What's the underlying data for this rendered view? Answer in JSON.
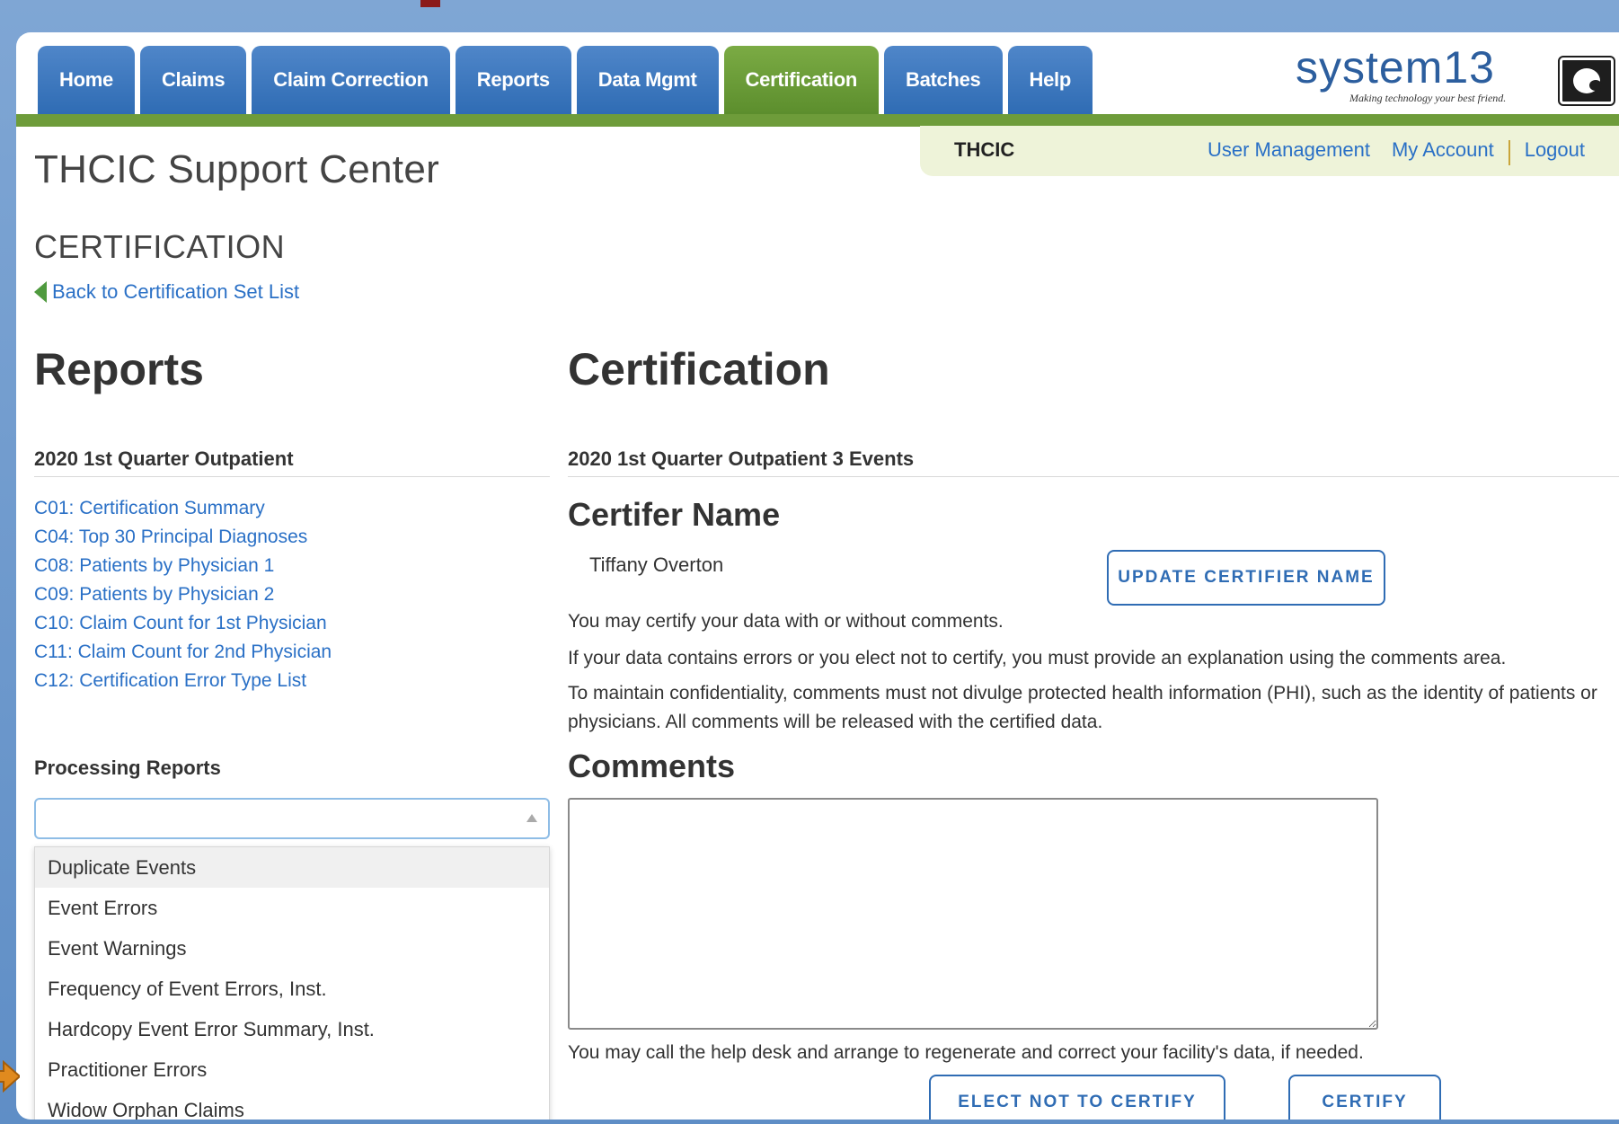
{
  "nav": {
    "tabs": [
      {
        "label": "Home",
        "active": false
      },
      {
        "label": "Claims",
        "active": false
      },
      {
        "label": "Claim Correction",
        "active": false
      },
      {
        "label": "Reports",
        "active": false
      },
      {
        "label": "Data Mgmt",
        "active": false
      },
      {
        "label": "Certification",
        "active": true
      },
      {
        "label": "Batches",
        "active": false
      },
      {
        "label": "Help",
        "active": false
      }
    ]
  },
  "logo": {
    "name": "system13",
    "tagline": "Making technology your best friend."
  },
  "userbar": {
    "org": "THCIC",
    "links": [
      "User Management",
      "My Account",
      "Logout"
    ]
  },
  "site_title": "THCIC Support Center",
  "section_title": "CERTIFICATION",
  "back_link": "Back to Certification Set List",
  "reports": {
    "heading": "Reports",
    "subheading": "2020 1st Quarter Outpatient",
    "links": [
      "C01: Certification Summary",
      "C04: Top 30 Principal Diagnoses",
      "C08: Patients by Physician 1",
      "C09: Patients by Physician 2",
      "C10: Claim Count for 1st Physician",
      "C11: Claim Count for 2nd Physician",
      "C12: Certification Error Type List"
    ],
    "processing_heading": "Processing Reports",
    "processing_value": "",
    "processing_options": [
      "Duplicate Events",
      "Event Errors",
      "Event Warnings",
      "Frequency of Event Errors, Inst.",
      "Hardcopy Event Error Summary, Inst.",
      "Practitioner Errors",
      "Widow Orphan Claims"
    ],
    "highlighted_option": "Duplicate Events"
  },
  "certification": {
    "heading": "Certification",
    "subheading": "2020 1st Quarter Outpatient 3 Events",
    "certifier_heading": "Certifer Name",
    "certifier_name": "Tiffany Overton",
    "update_button": "UPDATE CERTIFIER NAME",
    "para1": "You may certify your data with or without comments.",
    "para2": "If your data contains errors or you elect not to certify, you must provide an explanation using the comments area.",
    "para3": "To maintain confidentiality, comments must not divulge protected health information (PHI), such as the identity of patients or physicians. All comments will be released with the certified data.",
    "comments_heading": "Comments",
    "comments_value": "",
    "help_note": "You may call the help desk and arrange to regenerate and correct your facility's data, if needed.",
    "elect_not_button": "ELECT NOT TO CERTIFY",
    "certify_button": "CERTIFY"
  },
  "colors": {
    "nav_blue": "#2f6cb4",
    "active_green": "#5c8e2d",
    "link_blue": "#2a70c6",
    "pointer_orange": "#e08a1e"
  }
}
